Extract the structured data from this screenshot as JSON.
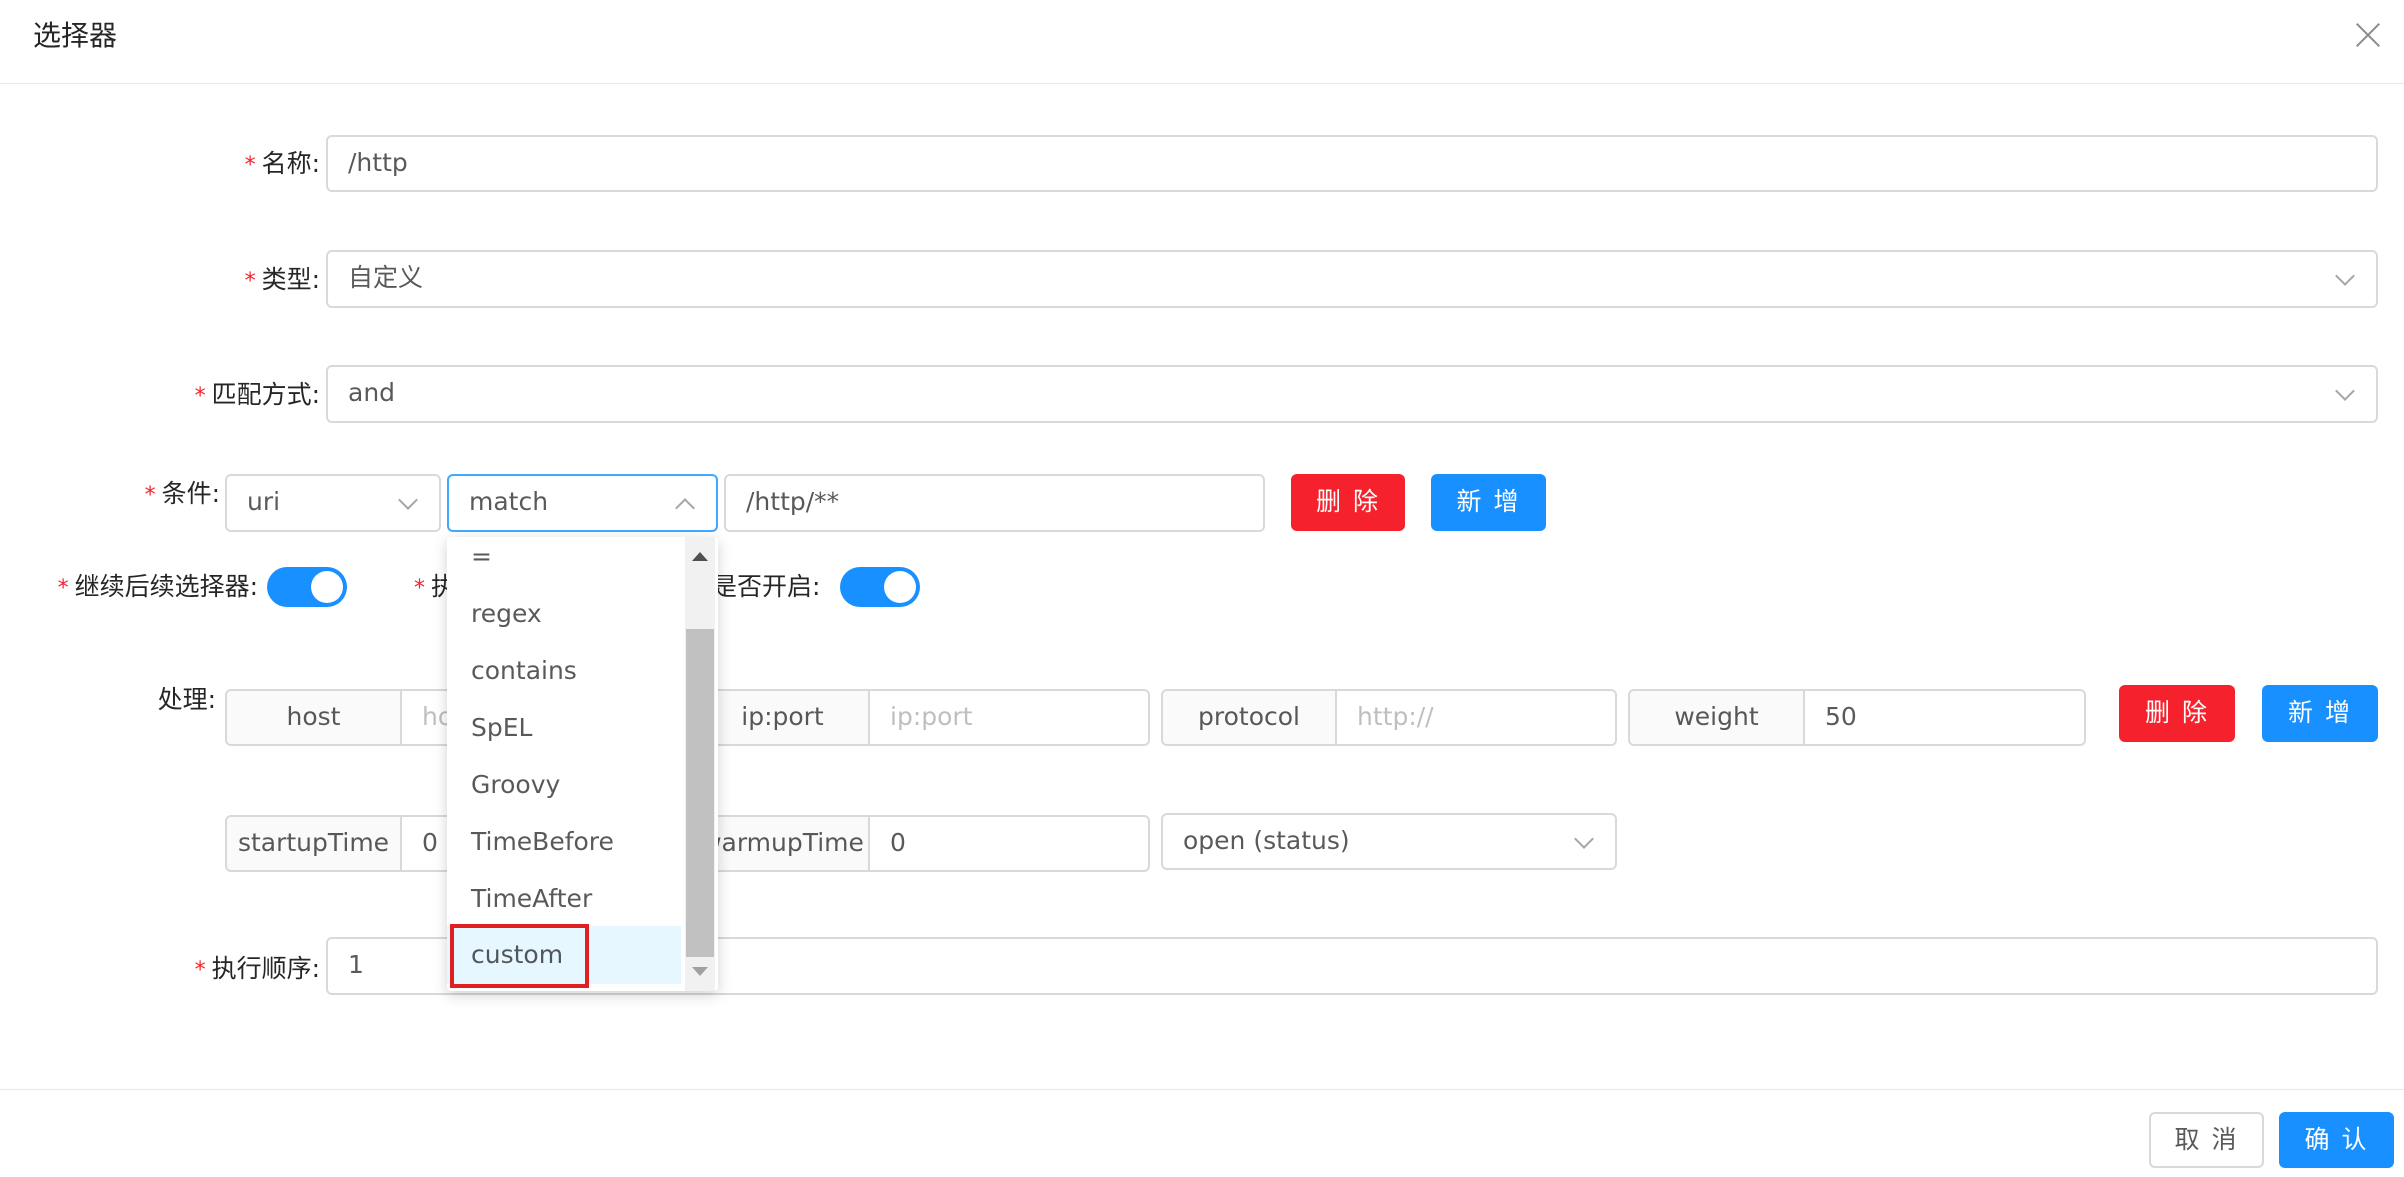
{
  "modal": {
    "title": "选择器"
  },
  "form": {
    "name": {
      "label": "名称:",
      "value": "/http"
    },
    "type": {
      "label": "类型:",
      "value": "自定义"
    },
    "match_mode": {
      "label": "匹配方式:",
      "value": "and"
    },
    "condition": {
      "label": "条件:",
      "param_type": "uri",
      "operator": "match",
      "value": "/http/**",
      "delete_label": "删 除",
      "add_label": "新 增",
      "operator_options": [
        "=",
        "regex",
        "contains",
        "SpEL",
        "Groovy",
        "TimeBefore",
        "TimeAfter",
        "custom"
      ],
      "highlighted_option": "custom"
    },
    "continued": {
      "label": "继续后续选择器:",
      "enabled": true
    },
    "hidden_field": {
      "label": "执"
    },
    "enabled": {
      "label": "是否开启:",
      "enabled": true
    },
    "handle": {
      "label": "处理:",
      "host": {
        "addon": "host",
        "placeholder": "host"
      },
      "ip_port": {
        "addon": "ip:port",
        "placeholder": "ip:port"
      },
      "protocol": {
        "addon": "protocol",
        "placeholder": "http://"
      },
      "weight": {
        "addon": "weight",
        "value": "50"
      },
      "startup_time": {
        "addon": "startupTime",
        "value": "0"
      },
      "warmup_time": {
        "addon": "warmupTime",
        "value": "0"
      },
      "status": {
        "value": "open (status)"
      },
      "delete_label": "删 除",
      "add_label": "新 增"
    },
    "sort": {
      "label": "执行顺序:",
      "value": "1"
    }
  },
  "footer": {
    "cancel_label": "取 消",
    "confirm_label": "确 认"
  },
  "colors": {
    "primary": "#1890ff",
    "danger": "#f5222d",
    "highlight": "#e02020"
  }
}
